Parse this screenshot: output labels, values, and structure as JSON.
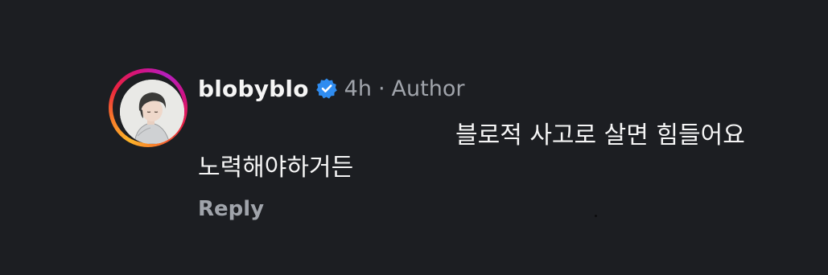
{
  "comment": {
    "username": "blobyblo",
    "verified_icon": "verified-badge-icon",
    "time": "4h",
    "separator": "·",
    "role": "Author",
    "text_line_1": "블로적 사고로 살면 힘들어요",
    "text_line_2": "노력해야하거든",
    "reply_label": "Reply"
  },
  "colors": {
    "background": "#1c1e22",
    "username": "#f5f5f5",
    "meta": "#a0a4ab",
    "verified": "#2f8cf0",
    "story_ring_gradient": [
      "#fdb52a",
      "#f7772a",
      "#e9233f",
      "#d3127f",
      "#b51fbf"
    ]
  }
}
